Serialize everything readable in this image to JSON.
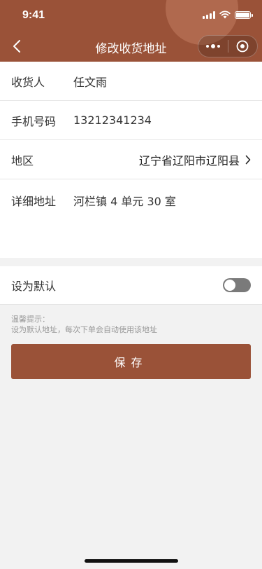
{
  "status_bar": {
    "time": "9:41"
  },
  "nav": {
    "title": "修改收货地址",
    "back_icon": "chevron-left-icon",
    "menu_icon": "more-dots-icon",
    "close_icon": "target-circle-icon"
  },
  "form": {
    "receiver": {
      "label": "收货人",
      "value": "任文雨"
    },
    "phone": {
      "label": "手机号码",
      "value": "13212341234"
    },
    "region": {
      "label": "地区",
      "value": "辽宁省辽阳市辽阳县"
    },
    "address": {
      "label": "详细地址",
      "value": "河栏镇 4 单元 30 室"
    }
  },
  "default_setting": {
    "label": "设为默认",
    "enabled": false
  },
  "tips": {
    "title": "温馨提示：",
    "text": "设为默认地址，每次下单会自动使用该地址"
  },
  "save_label": "保存",
  "colors": {
    "brand": "#9a5238",
    "toggle_off": "#7a7a7a"
  }
}
